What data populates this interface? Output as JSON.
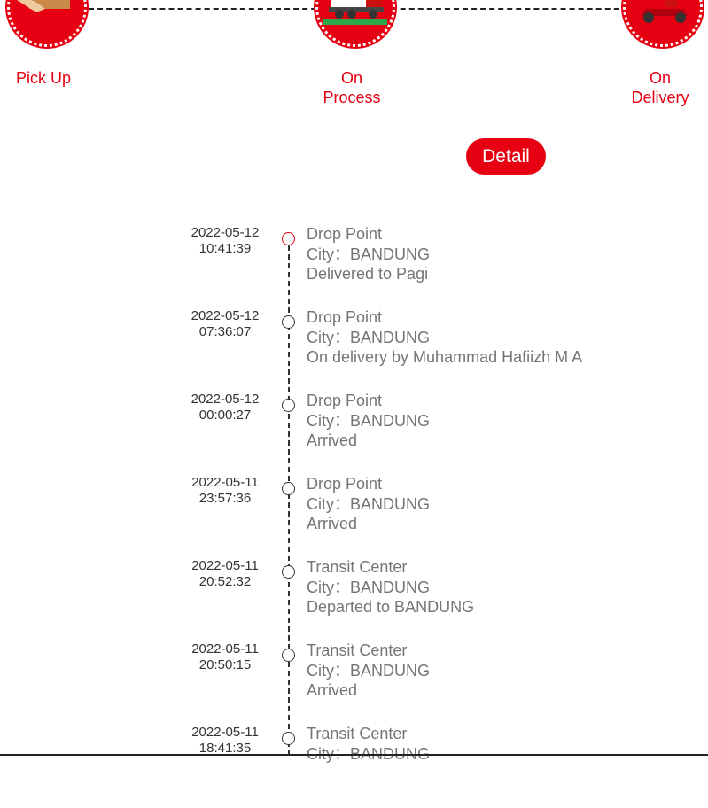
{
  "steps": [
    {
      "label": "Pick Up",
      "icon": "pickup-package-icon"
    },
    {
      "label_line1": "On",
      "label_line2": "Process",
      "icon": "delivery-truck-icon"
    },
    {
      "label_line1": "On",
      "label_line2": "Delivery",
      "icon": "delivery-courier-icon"
    }
  ],
  "detail_button": "Detail",
  "colors": {
    "accent": "#e60012",
    "text_gray": "#757575",
    "date_text": "#333333"
  },
  "timeline": [
    {
      "date": "2022-05-12",
      "time": "10:41:39",
      "place": "Drop Point",
      "city": "City：BANDUNG",
      "status": "Delivered to Pagi"
    },
    {
      "date": "2022-05-12",
      "time": "07:36:07",
      "place": "Drop Point",
      "city": "City：BANDUNG",
      "status": "On delivery by Muhammad Hafiizh M A"
    },
    {
      "date": "2022-05-12",
      "time": "00:00:27",
      "place": "Drop Point",
      "city": "City：BANDUNG",
      "status": "Arrived"
    },
    {
      "date": "2022-05-11",
      "time": "23:57:36",
      "place": "Drop Point",
      "city": "City：BANDUNG",
      "status": "Arrived"
    },
    {
      "date": "2022-05-11",
      "time": "20:52:32",
      "place": "Transit Center",
      "city": "City：BANDUNG",
      "status": "Departed to BANDUNG"
    },
    {
      "date": "2022-05-11",
      "time": "20:50:15",
      "place": "Transit Center",
      "city": "City：BANDUNG",
      "status": "Arrived"
    },
    {
      "date": "2022-05-11",
      "time": "18:41:35",
      "place": "Transit Center",
      "city": "City：BANDUNG",
      "status": ""
    }
  ]
}
